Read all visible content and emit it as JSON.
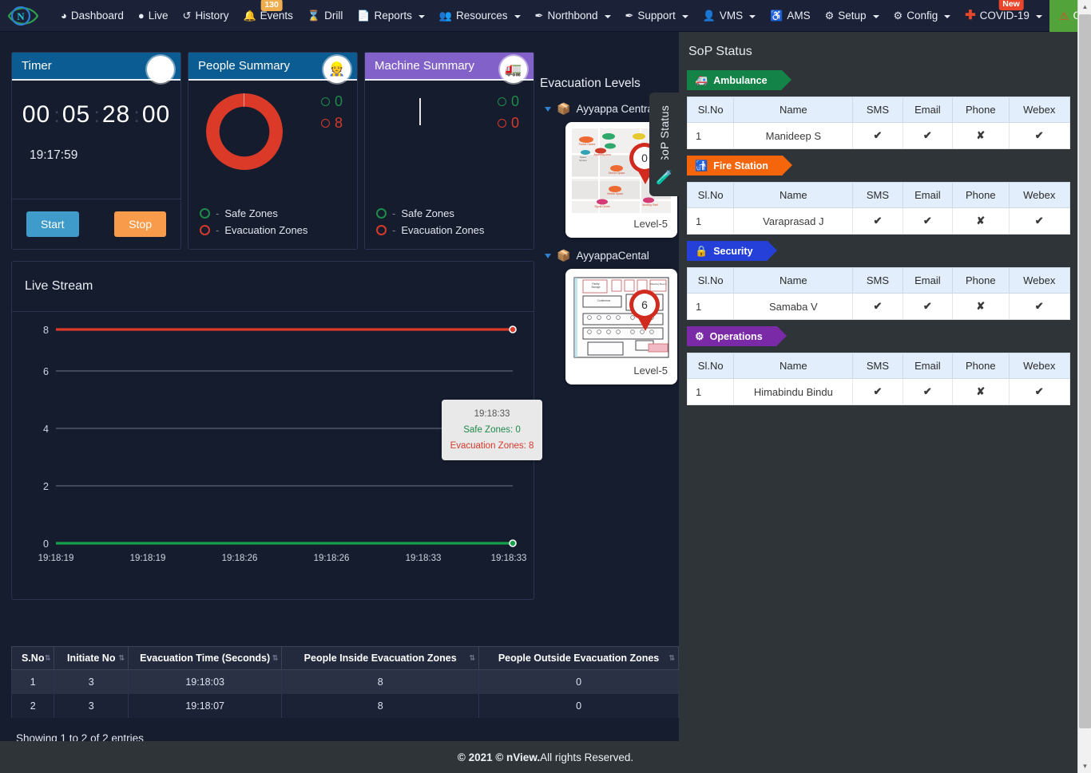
{
  "navbar": {
    "brand_icon": "nview-eye-logo",
    "items": [
      {
        "label": "Dashboard",
        "icon": "dashboard-icon",
        "caret": false,
        "badge": null
      },
      {
        "label": "Live",
        "icon": "location-pin-icon",
        "caret": false,
        "badge": null
      },
      {
        "label": "History",
        "icon": "history-icon",
        "caret": false,
        "badge": null
      },
      {
        "label": "Events",
        "icon": "bell-icon",
        "caret": false,
        "badge": "130"
      },
      {
        "label": "Drill",
        "icon": "hourglass-icon",
        "caret": false,
        "badge": null
      },
      {
        "label": "Reports",
        "icon": "report-file-icon",
        "caret": true,
        "badge": null
      },
      {
        "label": "Resources",
        "icon": "resources-icon",
        "caret": true,
        "badge": null
      },
      {
        "label": "Northbond",
        "icon": "feather-icon",
        "caret": true,
        "badge": null
      },
      {
        "label": "Support",
        "icon": "feather-icon",
        "caret": true,
        "badge": null
      },
      {
        "label": "VMS",
        "icon": "user-icon",
        "caret": true,
        "badge": null
      },
      {
        "label": "AMS",
        "icon": "accessibility-icon",
        "caret": false,
        "badge": null
      },
      {
        "label": "Setup",
        "icon": "gears-icon",
        "caret": true,
        "badge": null
      },
      {
        "label": "Config",
        "icon": "gear-icon",
        "caret": true,
        "badge": null
      },
      {
        "label": "COVID-19",
        "icon": "medical-cross-icon",
        "caret": true,
        "badge": "New"
      }
    ],
    "code_red": {
      "label": "Code Red",
      "icon": "warning-triangle-icon",
      "color": "#52a339"
    },
    "right": {
      "info_icon": "info-icon",
      "siren_icon": "siren-light-icon",
      "user_icon": "user-avatar-icon"
    }
  },
  "timer": {
    "title": "Timer",
    "icon": "stopwatch-icon",
    "digits": [
      "00",
      "05",
      "28",
      "00"
    ],
    "separator": ":",
    "clock": "19:17:59",
    "start_label": "Start",
    "stop_label": "Stop",
    "start_color": "#3f9bc9",
    "stop_color": "#f89b4a",
    "header_color": "#0a5c92"
  },
  "people_summary": {
    "title": "People Summary",
    "icon": "worker-helmet-icon",
    "header_color": "#0a5c92",
    "safe_count": "0",
    "evac_count": "8",
    "legend": [
      "Safe Zones",
      "Evacuation Zones"
    ],
    "dash": "-",
    "safe_color": "#1e8a4a",
    "evac_color": "#d6392b"
  },
  "machine_summary": {
    "title": "Machine Summary",
    "icon": "dump-truck-icon",
    "header_color": "#8261c9",
    "safe_count": "0",
    "evac_count": "0",
    "legend": [
      "Safe Zones",
      "Evacuation Zones"
    ],
    "dash": "-"
  },
  "live_stream": {
    "title": "Live Stream"
  },
  "chart_data": {
    "type": "line",
    "title": "Live Stream",
    "xlabel": "",
    "ylabel": "",
    "ylim": [
      0,
      8
    ],
    "yticks": [
      0,
      2,
      4,
      6,
      8
    ],
    "grid": true,
    "legend_position": "none",
    "x": [
      "19:18:19",
      "19:18:19",
      "19:18:26",
      "19:18:26",
      "19:18:33",
      "19:18:33"
    ],
    "series": [
      {
        "name": "Evacuation Zones",
        "color": "#dc3a28",
        "values": [
          8,
          8,
          8,
          8,
          8,
          8
        ]
      },
      {
        "name": "Safe Zones",
        "color": "#17a04a",
        "values": [
          0,
          0,
          0,
          0,
          0,
          0
        ]
      }
    ],
    "tooltip": {
      "time": "19:18:33",
      "safe_label": "Safe Zones: 0",
      "evac_label": "Evacuation Zones: 8"
    }
  },
  "evacuation": {
    "title": "Evacuation Levels",
    "nodes": [
      {
        "label": "Ayyappa Central",
        "icon": "cube-icon",
        "level": "Level-5",
        "marker": "0",
        "map": "street-map"
      },
      {
        "label": "AyyappaCental",
        "icon": "cube-icon",
        "level": "Level-5",
        "marker": "6",
        "map": "floor-plan"
      }
    ]
  },
  "sop_tab": {
    "label": "SoP Status",
    "icon": "medical-bottle-icon"
  },
  "evac_table": {
    "columns": [
      "S.No",
      "Initiate No",
      "Evacuation Time (Seconds)",
      "People Inside Evacuation Zones",
      "People Outside Evacuation Zones"
    ],
    "rows": [
      [
        "1",
        "3",
        "19:18:03",
        "8",
        "0"
      ],
      [
        "2",
        "3",
        "19:18:07",
        "8",
        "0"
      ]
    ],
    "info": "Showing 1 to 2 of 2 entries"
  },
  "sop_status": {
    "title": "SoP Status",
    "columns": [
      "Sl.No",
      "Name",
      "SMS",
      "Email",
      "Phone",
      "Webex"
    ],
    "groups": [
      {
        "label": "Ambulance",
        "icon": "ambulance-icon",
        "color": "#148348",
        "rows": [
          {
            "sl": "1",
            "name": "Manideep S",
            "sms": "✔",
            "email": "✔",
            "phone": "✘",
            "webex": "✔"
          }
        ]
      },
      {
        "label": "Fire Station",
        "icon": "fire-hydrant-icon",
        "color": "#f4650c",
        "rows": [
          {
            "sl": "1",
            "name": "Varaprasad J",
            "sms": "✔",
            "email": "✔",
            "phone": "✘",
            "webex": "✔"
          }
        ]
      },
      {
        "label": "Security",
        "icon": "lock-icon",
        "color": "#2540d8",
        "rows": [
          {
            "sl": "1",
            "name": "Samaba V",
            "sms": "✔",
            "email": "✔",
            "phone": "✘",
            "webex": "✔"
          }
        ]
      },
      {
        "label": "Operations",
        "icon": "gears-icon",
        "color": "#7a2aa6",
        "rows": [
          {
            "sl": "1",
            "name": "Himabindu Bindu",
            "sms": "✔",
            "email": "✔",
            "phone": "✘",
            "webex": "✔"
          }
        ]
      }
    ]
  },
  "footer": {
    "copyright": "© 2021 © nView.",
    "rights": " All rights Reserved."
  }
}
